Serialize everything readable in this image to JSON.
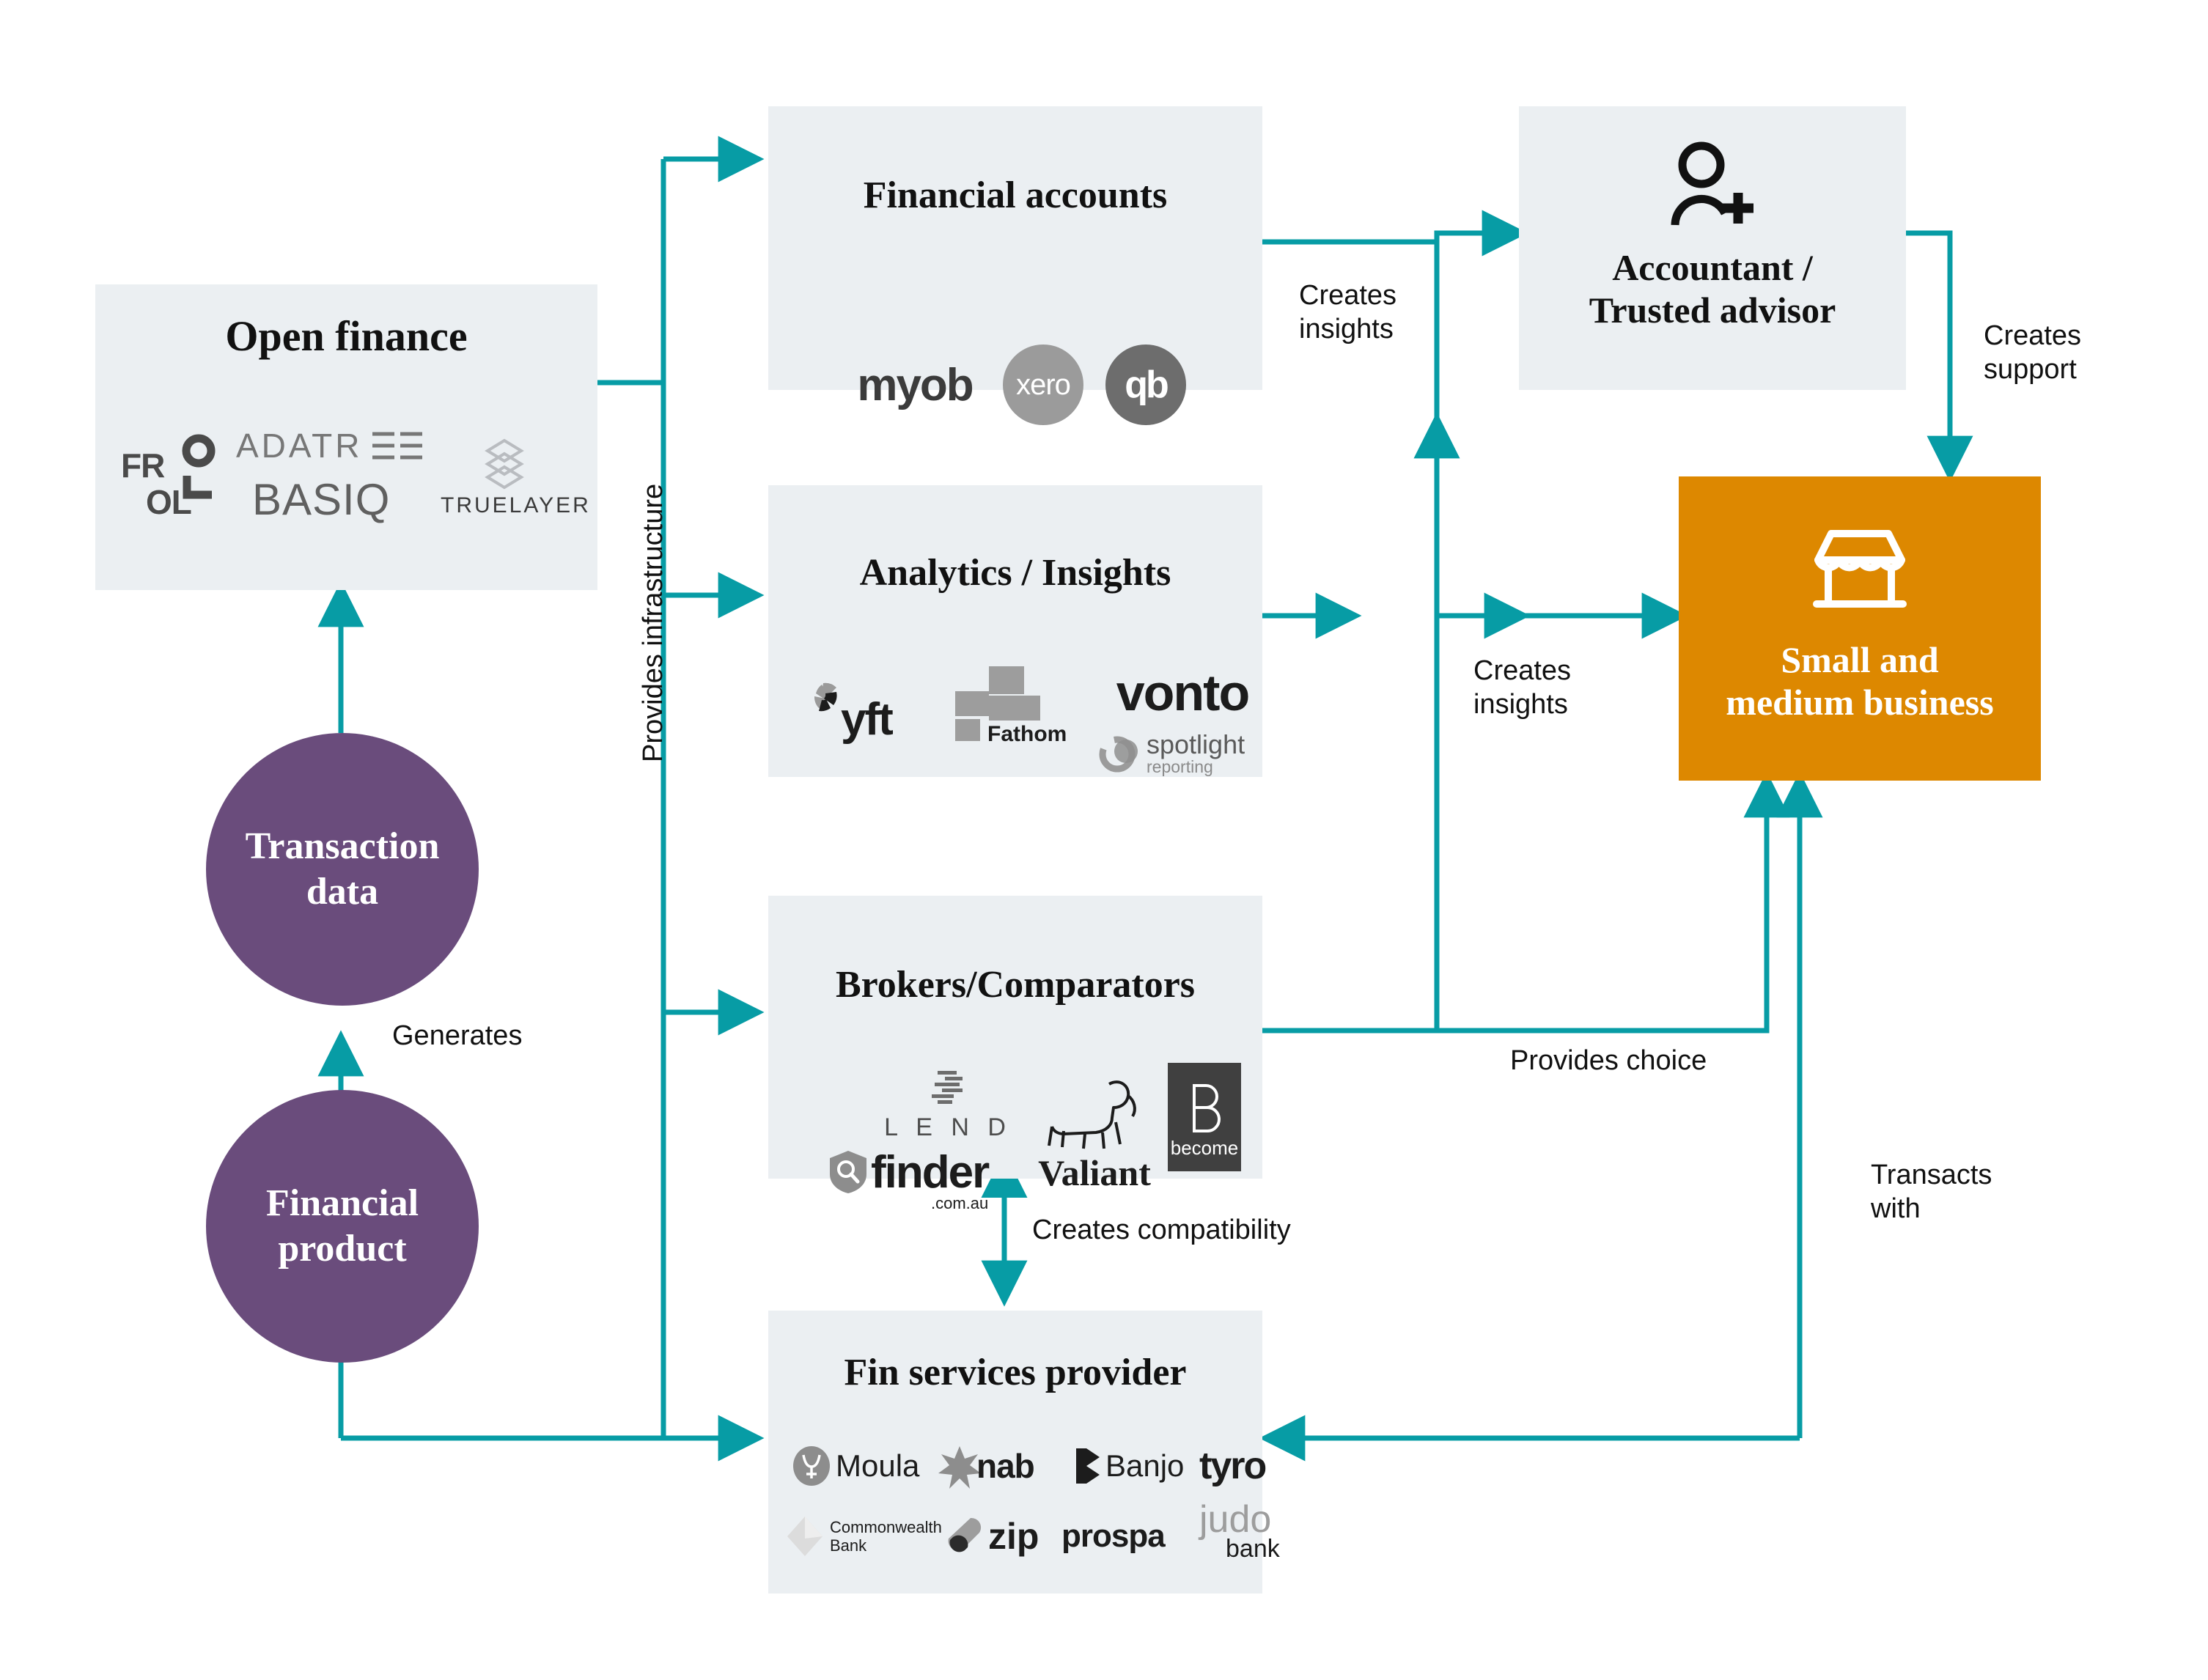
{
  "diagram": {
    "title_hidden": "",
    "colors": {
      "accent_teal": "#079CA5",
      "box_bg": "#EBEFF2",
      "circle_purple": "#6A4C7C",
      "highlight_orange": "#DD8800",
      "text_dark": "#111111"
    }
  },
  "nodes": {
    "open_finance": {
      "label": "Open finance",
      "logos": [
        "FROLLO",
        "ADATREE",
        "BASIQ",
        "TRUELAYER"
      ]
    },
    "transaction_data": {
      "label": "Transaction\ndata",
      "line1": "Transaction",
      "line2": "data"
    },
    "financial_product": {
      "label": "Financial\nproduct",
      "line1": "Financial",
      "line2": "product"
    },
    "financial_accounts": {
      "label": "Financial accounts",
      "logos": [
        "myob",
        "xero",
        "qb"
      ]
    },
    "analytics_insights": {
      "label": "Analytics / Insights",
      "logos": [
        "Syft",
        "Fathom",
        "vonto",
        "spotlight reporting"
      ]
    },
    "brokers_comparators": {
      "label": "Brokers/Comparators",
      "logos": [
        "LEND",
        "finder.com.au",
        "Valiant",
        "become"
      ]
    },
    "fin_services_provider": {
      "label": "Fin services provider",
      "logos": [
        "Moula",
        "nab",
        "Banjo",
        "tyro",
        "Commonwealth Bank",
        "zip",
        "prospa",
        "judo bank"
      ]
    },
    "accountant": {
      "label": "Accountant /\nTrusted advisor",
      "line1": "Accountant /",
      "line2": "Trusted advisor",
      "icon": "person-plus-icon"
    },
    "smb": {
      "label": "Small and\nmedium business",
      "line1": "Small and",
      "line2": "medium business",
      "icon": "storefront-icon"
    }
  },
  "edges": {
    "provides_infrastructure": "Provides infrastructure",
    "generates": "Generates",
    "creates_insights_top": "Creates\ninsights",
    "creates_insights_mid": "Creates\ninsights",
    "creates_support": "Creates\nsupport",
    "provides_choice": "Provides choice",
    "creates_compatibility": "Creates compatibility",
    "transacts_with": "Transacts\nwith"
  },
  "logo_text": {
    "myob": "myob",
    "xero": "xero",
    "qb": "qb",
    "syft": "yft",
    "fathom": "Fathom",
    "vonto": "vonto",
    "spotlight_1": "spotlight",
    "spotlight_2": "reporting",
    "lend": "L E N D",
    "finder": "finder",
    "finder_tld": ".com.au",
    "valiant": "Valiant",
    "become": "become",
    "moula": "Moula",
    "nab": "nab",
    "banjo": "Banjo",
    "tyro": "tyro",
    "cba_1": "Commonwealth",
    "cba_2": "Bank",
    "zip": "zip",
    "prospa": "prospa",
    "judo_1": "judo",
    "judo_2": "bank",
    "frollo_fr": "FR",
    "frollo_ol": "OL",
    "adatree": "ADATREE",
    "basiq": "BASIQ",
    "truelayer": "TRUELAYER"
  }
}
